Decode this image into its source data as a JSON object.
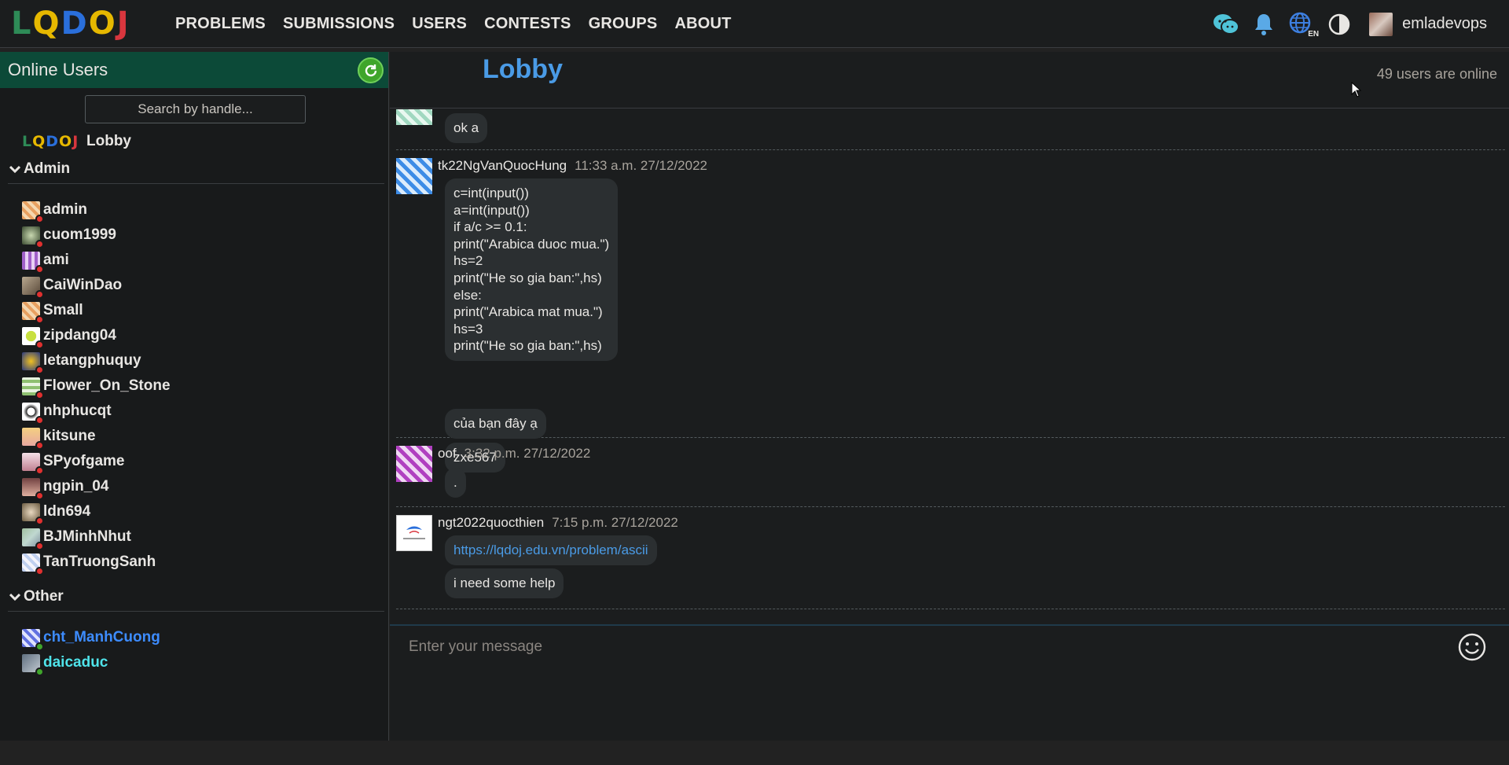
{
  "nav": {
    "logo_letters": [
      "L",
      "Q",
      "D",
      "O",
      "J"
    ],
    "logo_colors": [
      "#2e8b57",
      "#e6b800",
      "#2a6fdb",
      "#e6b800",
      "#d9363e"
    ],
    "links": [
      "PROBLEMS",
      "SUBMISSIONS",
      "USERS",
      "CONTESTS",
      "GROUPS",
      "ABOUT"
    ],
    "lang_badge": "EN",
    "username": "emladevops"
  },
  "sidebar": {
    "title": "Online Users",
    "search_placeholder": "Search by handle...",
    "lobby_label": "Lobby",
    "admin_label": "Admin",
    "other_label": "Other",
    "admins": [
      "admin",
      "cuom1999",
      "ami",
      "CaiWinDao",
      "Small",
      "zipdang04",
      "letangphuquy",
      "Flower_On_Stone",
      "nhphucqt",
      "kitsune",
      "SPyofgame",
      "ngpin_04",
      "ldn694",
      "BJMinhNhut",
      "TanTruongSanh"
    ],
    "others": [
      "cht_ManhCuong",
      "daicaduc"
    ]
  },
  "chat": {
    "room_title": "Lobby",
    "online_count": "49 users are online",
    "messages": [
      {
        "text": "ok a"
      },
      {
        "user": "tk22NgVanQuocHung",
        "time": "11:33 a.m. 27/12/2022",
        "code": "c=int(input())\na=int(input())\nif a/c >= 0.1:\nprint(\"Arabica duoc mua.\")\nhs=2\nprint(\"He so gia ban:\",hs)\nelse:\nprint(\"Arabica mat mua.\")\nhs=3\nprint(\"He so gia ban:\",hs)",
        "text2": "của bạn đây ạ",
        "text3": "zxe567"
      },
      {
        "user": "oof",
        "time": "3:32 p.m. 27/12/2022",
        "text": "."
      },
      {
        "user": "ngt2022quocthien",
        "time": "7:15 p.m. 27/12/2022",
        "link": "https://lqdoj.edu.vn/problem/ascii",
        "text": "i need some help"
      }
    ],
    "composer_placeholder": "Enter your message"
  },
  "colors": {
    "accent_blue": "#4a9be6",
    "sidebar_header": "#0c4a38",
    "offline_dot": "#e0302f",
    "online_dot": "#3fa52b"
  }
}
